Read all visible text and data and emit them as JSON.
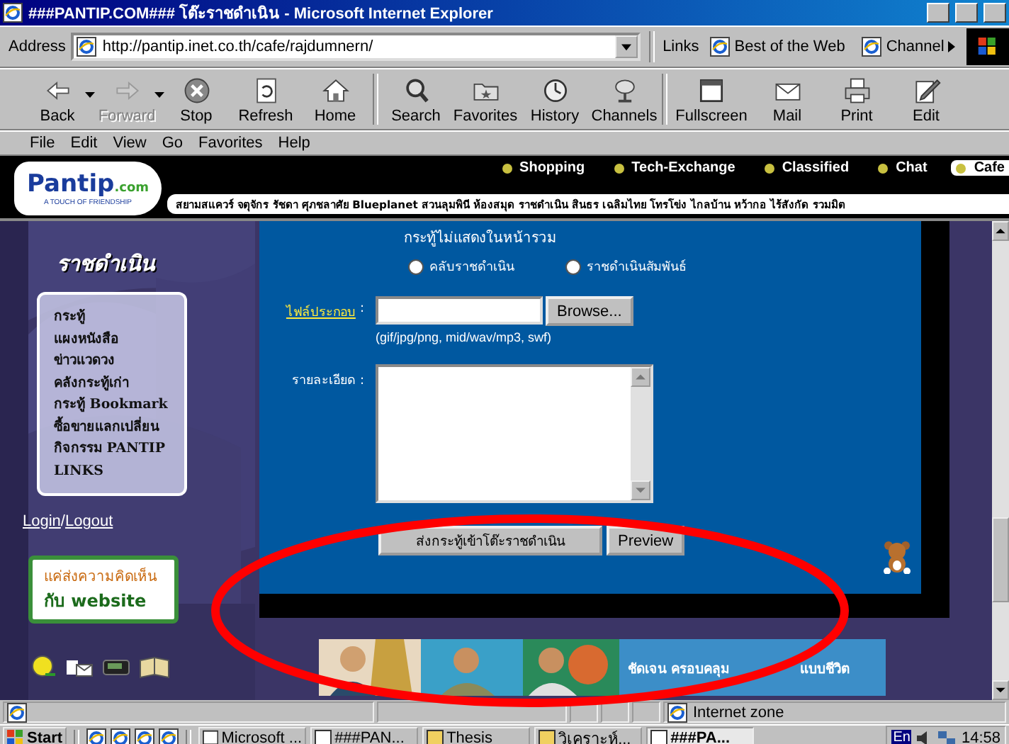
{
  "window": {
    "title": "###PANTIP.COM### โต๊ะราชดำเนิน - Microsoft Internet Explorer"
  },
  "address_bar": {
    "label": "Address",
    "url": "http://pantip.inet.co.th/cafe/rajdumnern/"
  },
  "links_bar": {
    "label": "Links",
    "items": [
      "Best of the Web",
      "Channel"
    ]
  },
  "toolbar": [
    {
      "buttons": [
        {
          "label": "Back",
          "disabled": false,
          "dropdown": true
        },
        {
          "label": "Forward",
          "disabled": true,
          "dropdown": true
        },
        {
          "label": "Stop",
          "disabled": false,
          "dropdown": false
        },
        {
          "label": "Refresh",
          "disabled": false,
          "dropdown": false
        },
        {
          "label": "Home",
          "disabled": false,
          "dropdown": false
        }
      ]
    },
    {
      "buttons": [
        {
          "label": "Search",
          "disabled": false,
          "dropdown": false
        },
        {
          "label": "Favorites",
          "disabled": false,
          "dropdown": false
        },
        {
          "label": "History",
          "disabled": false,
          "dropdown": false
        },
        {
          "label": "Channels",
          "disabled": false,
          "dropdown": false
        }
      ]
    },
    {
      "buttons": [
        {
          "label": "Fullscreen",
          "disabled": false,
          "dropdown": false
        },
        {
          "label": "Mail",
          "disabled": false,
          "dropdown": false
        },
        {
          "label": "Print",
          "disabled": false,
          "dropdown": false
        },
        {
          "label": "Edit",
          "disabled": false,
          "dropdown": false
        }
      ]
    }
  ],
  "menu": [
    "File",
    "Edit",
    "View",
    "Go",
    "Favorites",
    "Help"
  ],
  "site": {
    "logo": {
      "name": "Pantip",
      "suffix": ".com",
      "tagline": "A TOUCH OF FRIENDSHIP"
    },
    "sections": [
      {
        "label": "Shopping",
        "selected": false
      },
      {
        "label": "Tech-Exchange",
        "selected": false
      },
      {
        "label": "Classified",
        "selected": false
      },
      {
        "label": "Chat",
        "selected": false
      },
      {
        "label": "Cafe",
        "selected": true
      }
    ],
    "rooms": "สยามสแควร์ จตุจักร รัชดา ศุภชลาศัย Blueplanet สวนลุมพินี ห้องสมุด ราชดำเนิน สินธร เฉลิมไทย โทรโข่ง ไกลบ้าน หว้ากอ ไร้สังกัด รวมมิต"
  },
  "sidebar": {
    "title": "ราชดำเนิน",
    "items": [
      "กระทู้",
      "แผงหนังสือ",
      "ข่าวแวดวง",
      "คลังกระทู้เก่า",
      "กระทู้ Bookmark",
      "ซื้อขายแลกเปลี่ยน",
      "กิจกรรม PANTIP",
      "LINKS"
    ],
    "login": "Login",
    "separator": "/",
    "logout": "Logout",
    "feedback": [
      "แค่ส่งความคิดเห็น",
      "กับ website"
    ]
  },
  "form": {
    "note": "กระทู้ไม่แสดงในหน้ารวม",
    "options": [
      {
        "label": "คลับราชดำเนิน",
        "selected": false
      },
      {
        "label": "ราชดำเนินสัมพันธ์",
        "selected": false
      }
    ],
    "file": {
      "label": "ไฟล์ประกอบ",
      "separator": ":",
      "button": "Browse...",
      "hint": "(gif/jpg/png, mid/wav/mp3, swf)"
    },
    "details": {
      "label": "รายละเอียด :"
    },
    "buttons": [
      "ส่งกระทู้เข้าโต๊ะราชดำเนิน",
      "Preview"
    ]
  },
  "banner": {
    "texts": [
      "ชัดเจน  ครอบคลุม",
      "แบบชีวิต"
    ]
  },
  "status_bar": {
    "zone": "Internet zone"
  },
  "taskbar": {
    "start": "Start",
    "tasks": [
      {
        "label": "Microsoft ...",
        "selected": false
      },
      {
        "label": "###PAN...",
        "selected": false
      },
      {
        "label": "Thesis",
        "selected": false
      },
      {
        "label": "วิเคราะห์...",
        "selected": false
      },
      {
        "label": "###PA...",
        "selected": true
      }
    ],
    "language": "En",
    "clock": "14:58"
  }
}
